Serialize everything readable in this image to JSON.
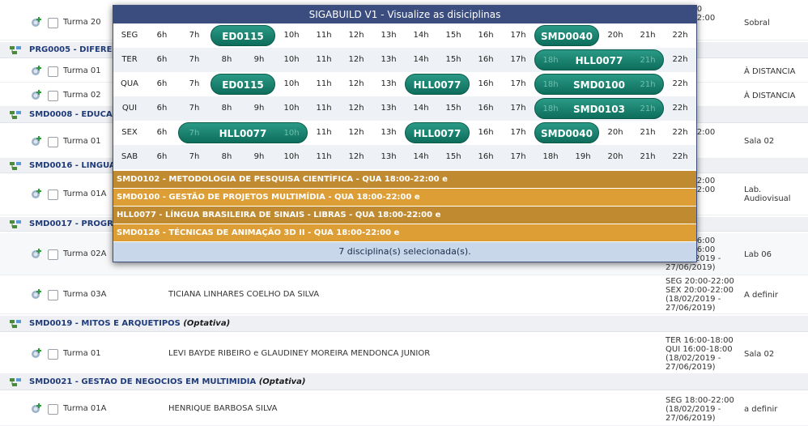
{
  "background": {
    "groups": [
      {
        "code_title": "PRG0005 - DIFEREN",
        "optativa": ""
      },
      {
        "code_title": "SMD0008 - EDUCAÇ",
        "optativa": ""
      },
      {
        "code_title": "SMD0016 - LINGUAG",
        "optativa": ""
      },
      {
        "code_title": "SMD0017 - PROGRA",
        "optativa": ""
      },
      {
        "code_title": "SMD0019 - MITOS E ARQUETIPOS",
        "optativa": "(Optativa)"
      },
      {
        "code_title": "SMD0021 - GESTAO DE NEGOCIOS EM MULTIMIDIA",
        "optativa": "(Optativa)"
      }
    ],
    "turmas": [
      {
        "label": "Turma 20",
        "prof": "",
        "sched": "30-17:30\n20:00-22:00\n2019 -\n2019)",
        "local": "Sobral"
      },
      {
        "label": "Turma 01",
        "prof": "",
        "sched": "",
        "local": "À DISTANCIA"
      },
      {
        "label": "Turma 02",
        "prof": "",
        "sched": "",
        "local": "À DISTANCIA"
      },
      {
        "label": "Turma 01",
        "prof": "",
        "sched": "20:00-12:00\n2019 -\n2019)",
        "local": "Sala 02"
      },
      {
        "label": "Turma 01A",
        "prof": "",
        "sched": "10:00-12:00\n10:00-12:00\n2019 -\n2019)",
        "local": "Lab.\nAudiovisual"
      },
      {
        "label": "Turma 02A",
        "prof": "",
        "sched": "16:00-16:00\n16:00-16:00\n(18/02/2019 -\n27/06/2019)",
        "local": "Lab 06"
      },
      {
        "label": "Turma 03A",
        "prof": "TICIANA LINHARES COELHO DA SILVA",
        "sched": "SEG 20:00-22:00\nSEX 20:00-22:00\n(18/02/2019 -\n27/06/2019)",
        "local": "A definir"
      },
      {
        "label": "Turma 01",
        "prof": "LEVI BAYDE RIBEIRO e GLAUDINEY MOREIRA MENDONCA JUNIOR",
        "sched": "TER 16:00-18:00\nQUI 16:00-18:00\n(18/02/2019 -\n27/06/2019)",
        "local": "Sala 02"
      },
      {
        "label": "Turma 01A",
        "prof": "HENRIQUE BARBOSA SILVA",
        "sched": "SEG 18:00-22:00\n(18/02/2019 -\n27/06/2019)",
        "local": "a definir"
      }
    ]
  },
  "popup": {
    "title": "SIGABUILD V1 - Visualize as disiciplinas",
    "days": [
      "SEG",
      "TER",
      "QUA",
      "QUI",
      "SEX",
      "SAB"
    ],
    "hours": [
      "6h",
      "7h",
      "8h",
      "9h",
      "10h",
      "11h",
      "12h",
      "13h",
      "14h",
      "15h",
      "16h",
      "17h",
      "18h",
      "19h",
      "20h",
      "21h",
      "22h"
    ],
    "blocks": [
      {
        "day": "SEG",
        "code": "ED0115",
        "start": "8h",
        "end": "9h",
        "hidden": []
      },
      {
        "day": "SEG",
        "code": "SMD0040",
        "start": "18h",
        "end": "19h",
        "hidden": []
      },
      {
        "day": "TER",
        "code": "HLL0077",
        "start": "18h",
        "end": "21h",
        "hidden": [
          "18h",
          "21h"
        ]
      },
      {
        "day": "QUA",
        "code": "ED0115",
        "start": "8h",
        "end": "9h",
        "hidden": []
      },
      {
        "day": "QUA",
        "code": "HLL0077",
        "start": "14h",
        "end": "15h",
        "hidden": []
      },
      {
        "day": "QUA",
        "code": "SMD0100",
        "start": "18h",
        "end": "21h",
        "hidden": [
          "18h",
          "21h"
        ]
      },
      {
        "day": "QUI",
        "code": "SMD0103",
        "start": "18h",
        "end": "21h",
        "hidden": [
          "18h",
          "21h"
        ]
      },
      {
        "day": "SEX",
        "code": "HLL0077",
        "start": "7h",
        "end": "10h",
        "hidden": [
          "7h",
          "10h"
        ]
      },
      {
        "day": "SEX",
        "code": "HLL0077",
        "start": "14h",
        "end": "15h",
        "hidden": []
      },
      {
        "day": "SEX",
        "code": "SMD0040",
        "start": "18h",
        "end": "19h",
        "hidden": []
      }
    ],
    "bars": [
      {
        "text": "SMD0102 - METODOLOGIA DE PESQUISA CIENTÍFICA - QUA 18:00-22:00 e",
        "color": "#c08a30"
      },
      {
        "text": "SMD0100 - GESTÃO DE PROJETOS MULTIMÍDIA - QUA 18:00-22:00 e",
        "color": "#dd9e35"
      },
      {
        "text": "HLL0077 - LÍNGUA BRASILEIRA DE SINAIS - LIBRAS - QUA 18:00-22:00 e",
        "color": "#c08a30"
      },
      {
        "text": "SMD0126 - TÉCNICAS DE ANIMAÇÃO 3D II - QUA 18:00-22:00 e",
        "color": "#dd9e35"
      }
    ],
    "footer": "7 disciplina(s) selecionada(s)."
  }
}
